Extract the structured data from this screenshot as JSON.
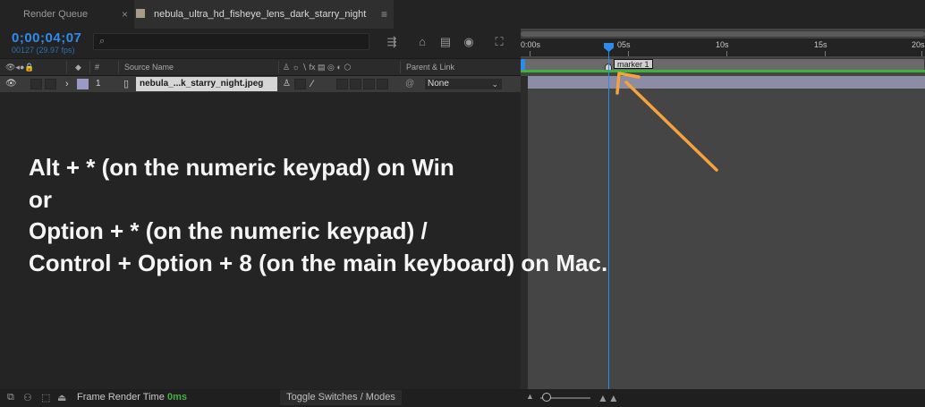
{
  "tabs": {
    "render_queue": "Render Queue",
    "comp_close": "×",
    "comp_name": "nebula_ultra_hd_fisheye_lens_dark_starry_night",
    "comp_menu": "≡"
  },
  "time": {
    "timecode": "0;00;04;07",
    "frames": "00127 (29.97 fps)"
  },
  "search": {
    "placeholder": "",
    "icon": "search-icon"
  },
  "columns": {
    "num": "#",
    "source_name": "Source Name",
    "switches_icons": "♙ ☼ ∖ fx ▤ ◎ ◐ ⬡",
    "parent_link": "Parent & Link"
  },
  "layer": {
    "index": "1",
    "name": "nebula_...k_starry_night.jpeg",
    "parent": "None"
  },
  "ruler": {
    "labels": [
      "0:00s",
      "05s",
      "10s",
      "15s",
      "20s"
    ]
  },
  "marker": {
    "label": "marker 1"
  },
  "annotation": {
    "lines": [
      "Alt + * (on the numeric keypad) on Win",
      "or",
      "Option + * (on the numeric keypad) /",
      "Control + Option + 8 (on the main keyboard) on Mac."
    ]
  },
  "status": {
    "frame_render_time_label": "Frame Render Time",
    "frame_render_time_value": "0ms",
    "toggle_label": "Toggle Switches / Modes"
  },
  "colors": {
    "accent": "#2d8ceb",
    "green": "#3fb13f",
    "arrow": "#f5a33c",
    "layer_bar": "#8d8ca5"
  }
}
